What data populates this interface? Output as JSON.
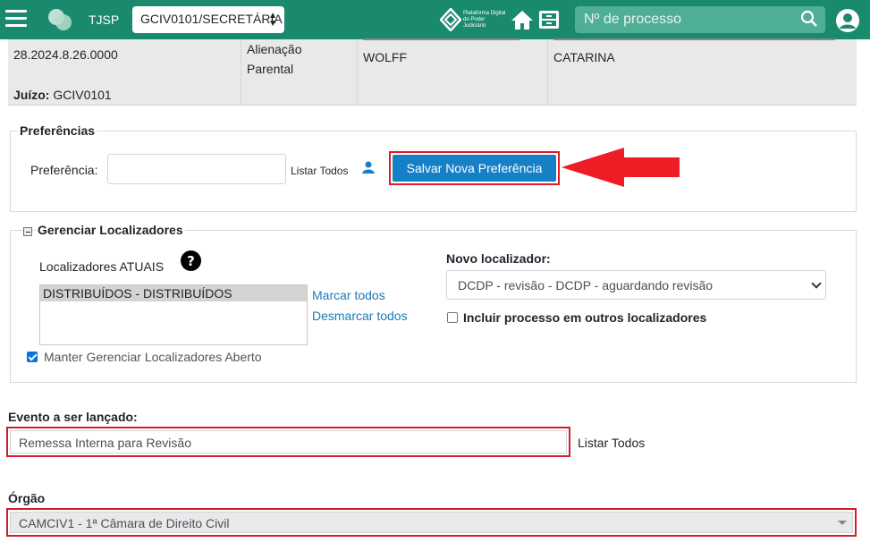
{
  "topbar": {
    "court": "TJSP",
    "unit_select": "GCIV0101/SECRETÁRIA",
    "pdpj_text": "Plataforma Digital do Poder Judiciário",
    "search_placeholder": "Nº de processo",
    "color": "#1a8a6e"
  },
  "process_header": {
    "number_tail": "28.2024.8.26.0000",
    "juizo_label": "Juízo:",
    "juizo_value": "GCIV0101",
    "class_line1": "Alienação",
    "class_line2": "Parental",
    "party1_line2": "WOLFF",
    "party2_line2": "CATARINA"
  },
  "preferencias": {
    "legend": "Preferências",
    "label": "Preferência:",
    "listar_todos": "Listar Todos",
    "save_button": "Salvar Nova Preferência"
  },
  "localizadores": {
    "legend": "Gerenciar Localizadores",
    "atuais_label": "Localizadores ATUAIS",
    "atuais_items": [
      "DISTRIBUÍDOS - DISTRIBUÍDOS"
    ],
    "marcar_todos": "Marcar todos",
    "desmarcar_todos": "Desmarcar todos",
    "keep_open_label": "Manter Gerenciar Localizadores Aberto",
    "keep_open_checked": true,
    "novo_label": "Novo localizador:",
    "novo_value": "DCDP - revisão - DCDP - aguardando revisão",
    "incluir_label": "Incluir processo em outros localizadores",
    "incluir_checked": false
  },
  "evento": {
    "label": "Evento a ser lançado:",
    "value": "Remessa Interna para Revisão",
    "listar_todos": "Listar Todos"
  },
  "orgao": {
    "label": "Órgão",
    "value": "CAMCIV1 - 1ª Câmara de Direito Civil"
  },
  "highlight_color": "#e01b24"
}
